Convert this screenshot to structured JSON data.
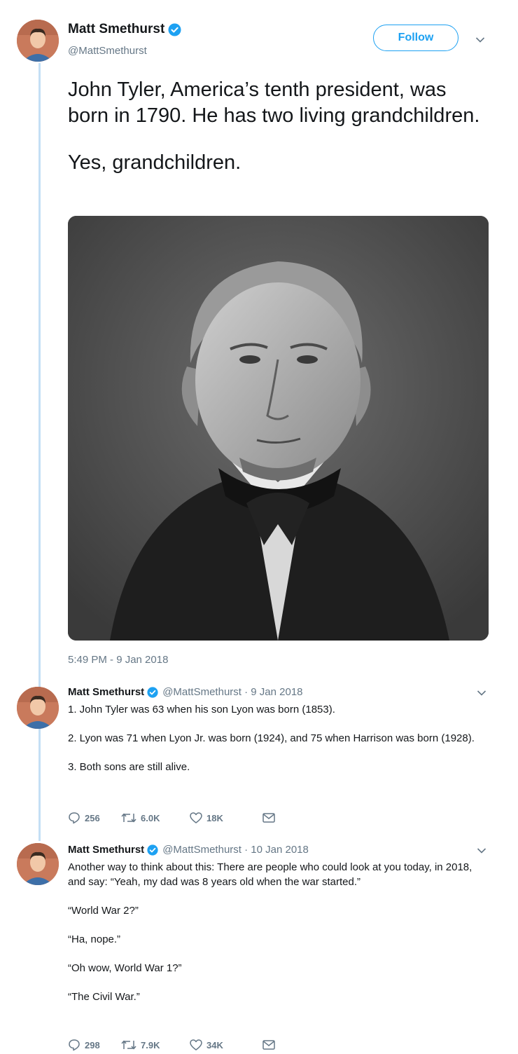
{
  "main_tweet": {
    "name": "Matt Smethurst",
    "handle": "@MattSmethurst",
    "follow_label": "Follow",
    "text_lines": [
      "John Tyler, America’s tenth president, was born in 1790. He has two living grandchildren.",
      "Yes, grandchildren."
    ],
    "timestamp": "5:49 PM - 9 Jan 2018"
  },
  "replies": [
    {
      "name": "Matt Smethurst",
      "meta": "@MattSmethurst · 9 Jan 2018",
      "paragraphs": [
        "1. John Tyler was 63 when his son Lyon was born (1853).",
        "2. Lyon was 71 when Lyon Jr. was born (1924), and 75 when Harrison was born (1928).",
        "3. Both sons are still alive."
      ],
      "replies_count": "256",
      "retweets_count": "6.0K",
      "likes_count": "18K"
    },
    {
      "name": "Matt Smethurst",
      "meta": "@MattSmethurst · 10 Jan 2018",
      "paragraphs": [
        "Another way to think about this: There are people who could look at you today, in 2018, and say: “Yeah, my dad was 8 years old when the war started.”",
        "“World War 2?”",
        "“Ha, nope.”",
        "“Oh wow, World War 1?”",
        "“The Civil War.”"
      ],
      "replies_count": "298",
      "retweets_count": "7.9K",
      "likes_count": "34K"
    }
  ],
  "colors": {
    "accent": "#1da1f2",
    "thread_line": "#c4dff5",
    "secondary_text": "#657786"
  },
  "icons": [
    "verified-icon",
    "chevron-down-icon",
    "reply-icon",
    "retweet-icon",
    "like-icon",
    "message-icon"
  ]
}
